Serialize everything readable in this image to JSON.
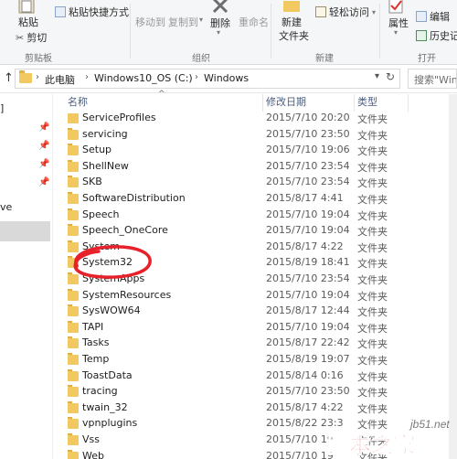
{
  "ribbon": {
    "clipboard": {
      "paste": "粘贴",
      "paste_shortcut": "粘贴快捷方式",
      "cut": "剪切",
      "group": "剪贴板"
    },
    "organize": {
      "move_to": "移动到",
      "copy_to": "复制到",
      "delete": "删除",
      "rename": "重命名",
      "group": "组织"
    },
    "new": {
      "new_folder_line1": "新建",
      "new_folder_line2": "文件夹",
      "easy_access": "轻松访问",
      "group": "新建"
    },
    "open": {
      "properties": "属性",
      "edit": "编辑",
      "history": "历史记",
      "group": "打开"
    }
  },
  "address": {
    "crumbs": [
      "此电脑",
      "Windows10_OS (C:)",
      "Windows"
    ],
    "search_placeholder": "搜索\"Windows\""
  },
  "nav": {
    "fragment_a": "]",
    "fragment_b": "ve"
  },
  "columns": {
    "name": "名称",
    "date": "修改日期",
    "type": "类型"
  },
  "files": [
    {
      "name": "ServiceProfiles",
      "date": "2015/7/10 20:20",
      "type": "文件夹"
    },
    {
      "name": "servicing",
      "date": "2015/7/10 23:50",
      "type": "文件夹"
    },
    {
      "name": "Setup",
      "date": "2015/7/10 19:06",
      "type": "文件夹"
    },
    {
      "name": "ShellNew",
      "date": "2015/7/10 23:54",
      "type": "文件夹"
    },
    {
      "name": "SKB",
      "date": "2015/7/10 23:54",
      "type": "文件夹"
    },
    {
      "name": "SoftwareDistribution",
      "date": "2015/8/17 4:41",
      "type": "文件夹"
    },
    {
      "name": "Speech",
      "date": "2015/7/10 19:04",
      "type": "文件夹"
    },
    {
      "name": "Speech_OneCore",
      "date": "2015/7/10 19:04",
      "type": "文件夹"
    },
    {
      "name": "System",
      "date": "2015/8/17 4:22",
      "type": "文件夹"
    },
    {
      "name": "System32",
      "date": "2015/8/19 18:41",
      "type": "文件夹"
    },
    {
      "name": "SystemApps",
      "date": "2015/7/10 23:54",
      "type": "文件夹"
    },
    {
      "name": "SystemResources",
      "date": "2015/7/10 19:04",
      "type": "文件夹"
    },
    {
      "name": "SysWOW64",
      "date": "2015/8/17 12:44",
      "type": "文件夹"
    },
    {
      "name": "TAPI",
      "date": "2015/7/10 19:04",
      "type": "文件夹"
    },
    {
      "name": "Tasks",
      "date": "2015/8/17 22:42",
      "type": "文件夹"
    },
    {
      "name": "Temp",
      "date": "2015/8/19 19:07",
      "type": "文件夹"
    },
    {
      "name": "ToastData",
      "date": "2015/8/14 0:16",
      "type": "文件夹"
    },
    {
      "name": "tracing",
      "date": "2015/7/10 23:50",
      "type": "文件夹"
    },
    {
      "name": "twain_32",
      "date": "2015/8/17 4:22",
      "type": "文件夹"
    },
    {
      "name": "vpnplugins",
      "date": "2015/8/22 23:3",
      "type": "文件夹"
    },
    {
      "name": "Vss",
      "date": "2015/7/10 19",
      "type": "文件夹"
    },
    {
      "name": "Web",
      "date": "2015/7/10 19",
      "type": "文件夹"
    }
  ],
  "watermark": {
    "text": "脚本之家",
    "site": "jb51.net"
  },
  "colors": {
    "folder": "#f2c961",
    "annotation": "#e8202a",
    "header_text": "#4d6082"
  }
}
